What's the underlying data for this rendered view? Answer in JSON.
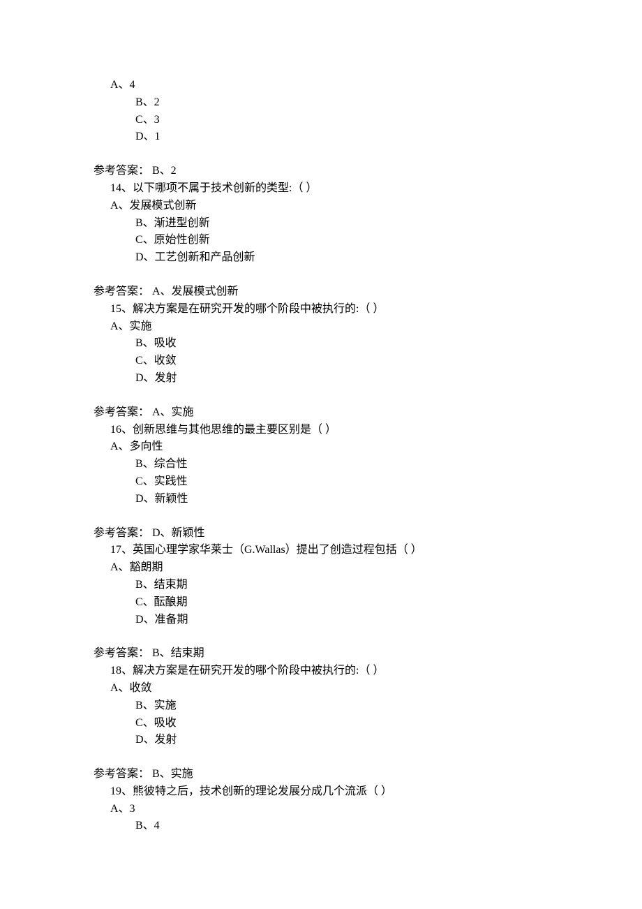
{
  "q13": {
    "optA": "A、4",
    "optB": "B、2",
    "optC": "C、3",
    "optD": "D、1",
    "answer": "参考答案：  B、2"
  },
  "q14": {
    "question": "14、以下哪项不属于技术创新的类型:（  ）",
    "optA": "A、发展模式创新",
    "optB": "B、渐进型创新",
    "optC": "C、原始性创新",
    "optD": "D、工艺创新和产品创新",
    "answer": "参考答案：  A、发展模式创新"
  },
  "q15": {
    "question": "15、解决方案是在研究开发的哪个阶段中被执行的:（  ）",
    "optA": "A、实施",
    "optB": "B、吸收",
    "optC": "C、收敛",
    "optD": "D、发射",
    "answer": "参考答案：  A、实施"
  },
  "q16": {
    "question": "16、创新思维与其他思维的最主要区别是（  ）",
    "optA": "A、多向性",
    "optB": "B、综合性",
    "optC": "C、实践性",
    "optD": "D、新颖性",
    "answer": "参考答案：  D、新颖性"
  },
  "q17": {
    "question": "17、英国心理学家华莱士（G.Wallas）提出了创造过程包括（  ）",
    "optA": "A、豁朗期",
    "optB": "B、结束期",
    "optC": "C、酝酿期",
    "optD": "D、准备期",
    "answer": "参考答案：  B、结束期"
  },
  "q18": {
    "question": "18、解决方案是在研究开发的哪个阶段中被执行的:（  ）",
    "optA": "A、收敛",
    "optB": "B、实施",
    "optC": "C、吸收",
    "optD": "D、发射",
    "answer": "参考答案：  B、实施"
  },
  "q19": {
    "question": "19、熊彼特之后，技术创新的理论发展分成几个流派（  ）",
    "optA": "A、3",
    "optB": "B、4"
  }
}
